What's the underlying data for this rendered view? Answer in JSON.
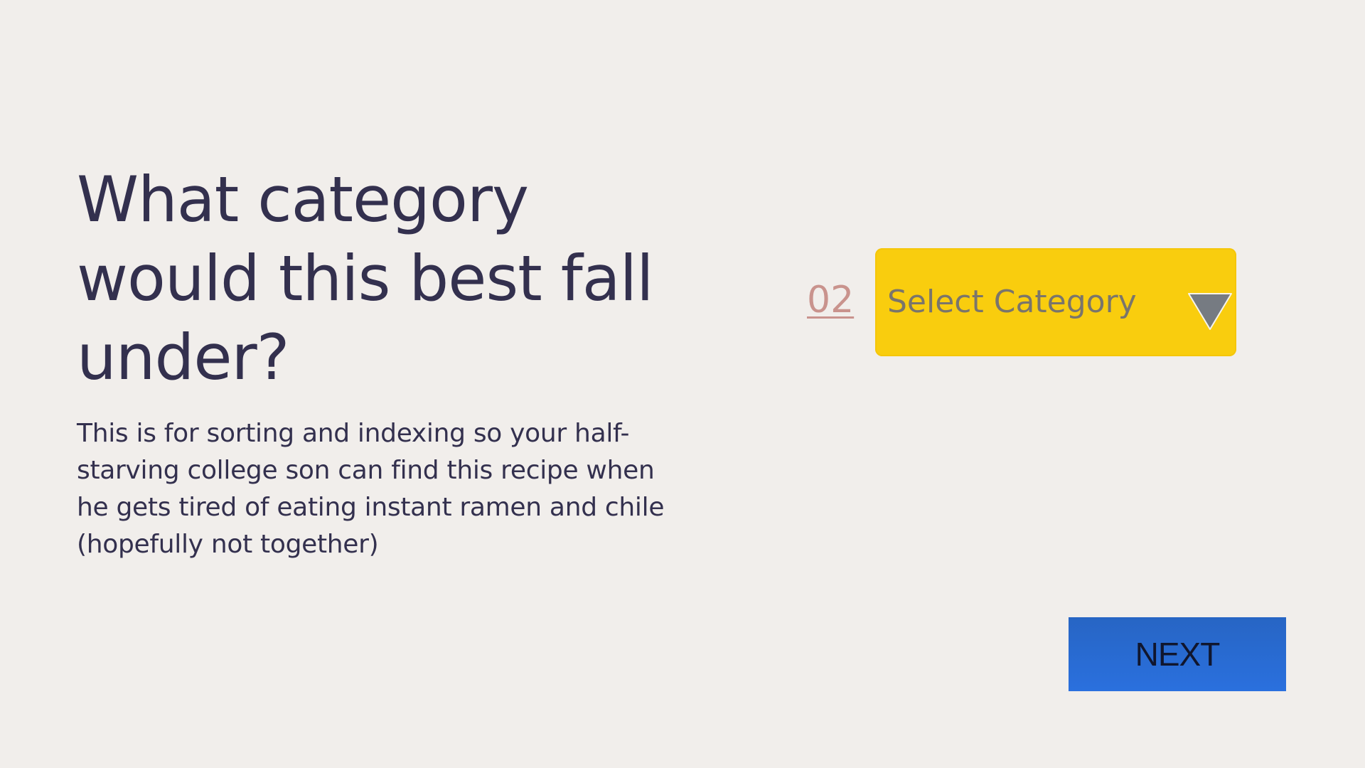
{
  "question": {
    "heading": "What category would this best fall under?",
    "description": "This is for sorting and indexing so your half-starving college son can find this recipe when he gets tired of eating instant ramen and chile (hopefully not together)"
  },
  "step": {
    "number": "02",
    "color": "#c9938d"
  },
  "category_select": {
    "label": "Select Category",
    "background_color": "#f9cd0e",
    "icon": "triangle-down-icon"
  },
  "next_button": {
    "label": "NEXT",
    "background_color": "#2a6bd6"
  },
  "colors": {
    "background": "#f1eeeb",
    "text": "#33304e"
  }
}
